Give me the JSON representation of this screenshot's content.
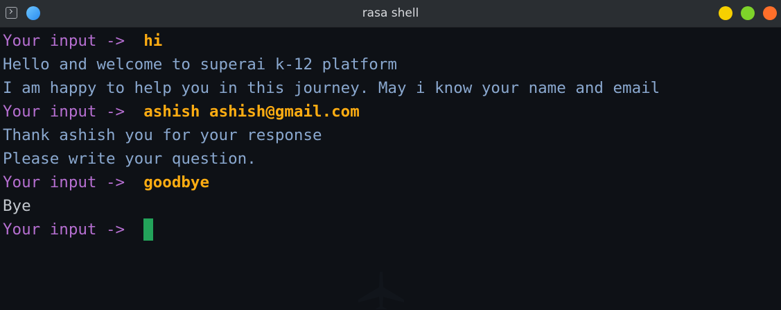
{
  "window": {
    "title": "rasa shell",
    "icons": [
      "terminal-app-icon",
      "pin-icon"
    ],
    "controls": [
      "minimize",
      "maximize",
      "close"
    ],
    "colors": {
      "minimize": "#f7d000",
      "maximize": "#7ed32a",
      "close": "#ff6f2a",
      "prompt": "#b66fd1",
      "user_input": "#ffad12",
      "bot_text": "#8aa8cf",
      "cursor": "#23a35a"
    }
  },
  "terminal": {
    "lines": [
      {
        "prompt": "Your input ->  ",
        "input": "hi"
      },
      {
        "text": "Hello and welcome to superai k-12 platform"
      },
      {
        "text": "I am happy to help you in this journey. May i know your name and email"
      },
      {
        "prompt": "Your input ->  ",
        "input": "ashish ashish@gmail.com"
      },
      {
        "text": "Thank ashish you for your response"
      },
      {
        "text": "Please write your question."
      },
      {
        "prompt": "Your input ->  ",
        "input": "goodbye"
      },
      {
        "text": "Bye"
      },
      {
        "prompt": "Your input ->  ",
        "input": ""
      }
    ]
  }
}
